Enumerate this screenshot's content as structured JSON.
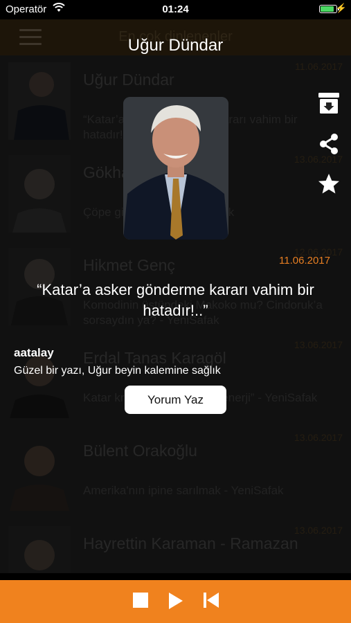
{
  "status_bar": {
    "carrier": "Operatör",
    "time": "01:24",
    "battery_color": "#4cd964"
  },
  "navbar": {
    "title": "En çok dinlenenler"
  },
  "list": [
    {
      "name": "Uğur Dündar",
      "date": "11.06.2017",
      "subtitle": "“Katar’a asker gönderme kararı vahim bir hatadır!..” - YeniSafak"
    },
    {
      "name": "Gökhan Özcan",
      "date": "13.06.2017",
      "subtitle": "Çöpe gitmek mi? - YeniSafak"
    },
    {
      "name": "Hikmet Genç",
      "date": "12.06.2017",
      "subtitle": "Komodinin üstündeki Makoko mu? Cindoruk’a sorsaydın ya? - YeniSafak"
    },
    {
      "name": "Erdal Tanas Karagöl",
      "date": "13.06.2017",
      "subtitle": "Katar krizinin arkasındaki “enerji” - YeniSafak"
    },
    {
      "name": "Bülent Orakoğlu",
      "date": "13.06.2017",
      "subtitle": "Amerika'nın ipine sarılmak - YeniSafak"
    },
    {
      "name": "Hayrettin Karaman - Ramazan",
      "date": "13.06.2017",
      "subtitle": ""
    }
  ],
  "overlay": {
    "title": "Uğur Dündar",
    "date": "11.06.2017",
    "quote": "“Katar’a asker gönderme kararı vahim bir hatadır!..”",
    "commenter": "aatalay",
    "comment": "Güzel bir yazı, Uğur beyin kalemine sağlık",
    "button_label": "Yorum Yaz",
    "icons": [
      "archive-icon",
      "share-icon",
      "star-icon"
    ]
  },
  "player": {
    "accent": "#f0821e",
    "icons": [
      "stop-icon",
      "play-icon",
      "skip-back-icon"
    ]
  }
}
